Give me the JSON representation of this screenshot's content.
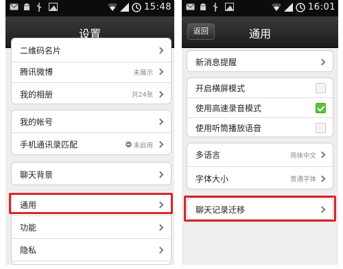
{
  "left_screen": {
    "status": {
      "time": "15:48"
    },
    "title": "设置",
    "group1": [
      {
        "label": "二维码名片",
        "value": ""
      },
      {
        "label": "腾讯微博",
        "value": "未展示"
      },
      {
        "label": "我的相册",
        "value": "共24张"
      }
    ],
    "group2": [
      {
        "label": "我的帐号",
        "value": ""
      },
      {
        "label": "手机通讯录匹配",
        "value": "未启用"
      }
    ],
    "group3": [
      {
        "label": "聊天背景",
        "value": ""
      }
    ],
    "group4": [
      {
        "label": "通用",
        "value": ""
      },
      {
        "label": "功能",
        "value": ""
      },
      {
        "label": "隐私",
        "value": ""
      }
    ]
  },
  "right_screen": {
    "status": {
      "time": "16:01"
    },
    "back_label": "返回",
    "title": "通用",
    "group1": [
      {
        "label": "新消息提醒"
      }
    ],
    "group2": [
      {
        "label": "开启横屏模式",
        "checked": false
      },
      {
        "label": "使用高速录音模式",
        "checked": true
      },
      {
        "label": "使用听筒播放语音",
        "checked": false
      }
    ],
    "group3": [
      {
        "label": "多语言",
        "value": "简体中文"
      },
      {
        "label": "字体大小",
        "value": "普通字体"
      }
    ],
    "group4": [
      {
        "label": "聊天记录迁移"
      }
    ]
  },
  "colors": {
    "highlight": "#d9262b",
    "check_on": "#5ec03a",
    "titlebar": "#2a2a2a"
  },
  "icons": [
    "mail-icon",
    "android-icon",
    "usb-icon",
    "image-icon",
    "wifi-icon",
    "signal-icon",
    "battery-icon",
    "chevron-right-icon",
    "checkbox-icon",
    "disabled-icon"
  ]
}
